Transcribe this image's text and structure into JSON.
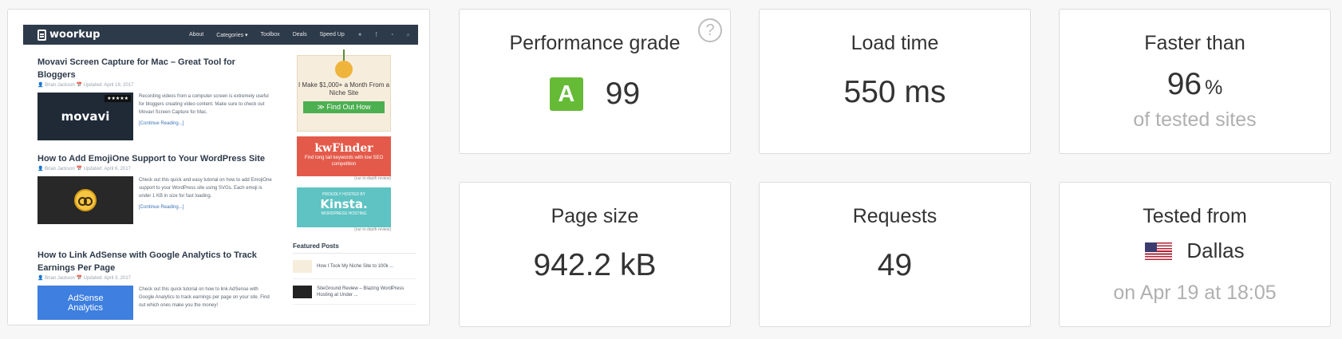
{
  "screenshot": {
    "site": {
      "logo": "woorkup",
      "menu": [
        "About",
        "Categories ▾",
        "Toolbox",
        "Deals",
        "Speed Up"
      ],
      "posts": [
        {
          "title": "Movavi Screen Capture for Mac – Great Tool for Bloggers",
          "meta": "👤 Brian Jackson  📅 Updated: April 19, 2017",
          "thumb": "movavi",
          "thumb_badge": "★★★★★",
          "text": "Recording videos from a computer screen is extremely useful for bloggers creating video content. Make sure to check out Movavi Screen Capture for Mac.",
          "more": "[Continue Reading...]"
        },
        {
          "title": "How to Add EmojiOne Support to Your WordPress Site",
          "meta": "👤 Brian Jackson  📅 Updated: April 6, 2017",
          "text": "Check out this quick and easy tutorial on how to add EmojiOne support to your WordPress site using SVGs. Each emoji is under 1 KB in size for fast loading.",
          "more": "[Continue Reading...]"
        },
        {
          "title": "How to Link AdSense with Google Analytics to Track Earnings Per Page",
          "meta": "👤 Brian Jackson  📅 Updated: April 3, 2017",
          "thumb": "AdSense Analytics",
          "text": "Check out this quick tutorial on how to link AdSense with Google Analytics to track earnings per page on your site. Find out which ones make you the money!",
          "more": ""
        }
      ],
      "ads": {
        "ad1_text": "I Make $1,000+ a Month From a Niche Site",
        "ad1_button": "≫ Find Out How",
        "ad2_logo": "kwFinder",
        "ad2_sub": "Find long tail keywords with low SEO competition",
        "review_note": "(our in-depth review)",
        "ad3_small": "PROUDLY HOSTED BY",
        "ad3_logo": "Kinsta.",
        "ad3_sub": "WORDPRESS HOSTING"
      },
      "featured_title": "Featured Posts",
      "featured": [
        "How I Took My Niche Site to 100k ...",
        "SiteGround Review – Blazing WordPress Hosting at Under ..."
      ]
    }
  },
  "metrics": {
    "performance": {
      "title": "Performance grade",
      "grade": "A",
      "score": "99",
      "help": "?"
    },
    "load_time": {
      "title": "Load time",
      "value": "550 ms"
    },
    "faster_than": {
      "title": "Faster than",
      "value": "96",
      "unit": "%",
      "sub": "of tested sites"
    },
    "page_size": {
      "title": "Page size",
      "value": "942.2 kB"
    },
    "requests": {
      "title": "Requests",
      "value": "49"
    },
    "tested_from": {
      "title": "Tested from",
      "city": "Dallas",
      "date": "on Apr 19 at 18:05"
    }
  },
  "colors": {
    "grade": "#66bb36",
    "nav": "#2d3a4a",
    "muted": "#b0b0b0"
  }
}
